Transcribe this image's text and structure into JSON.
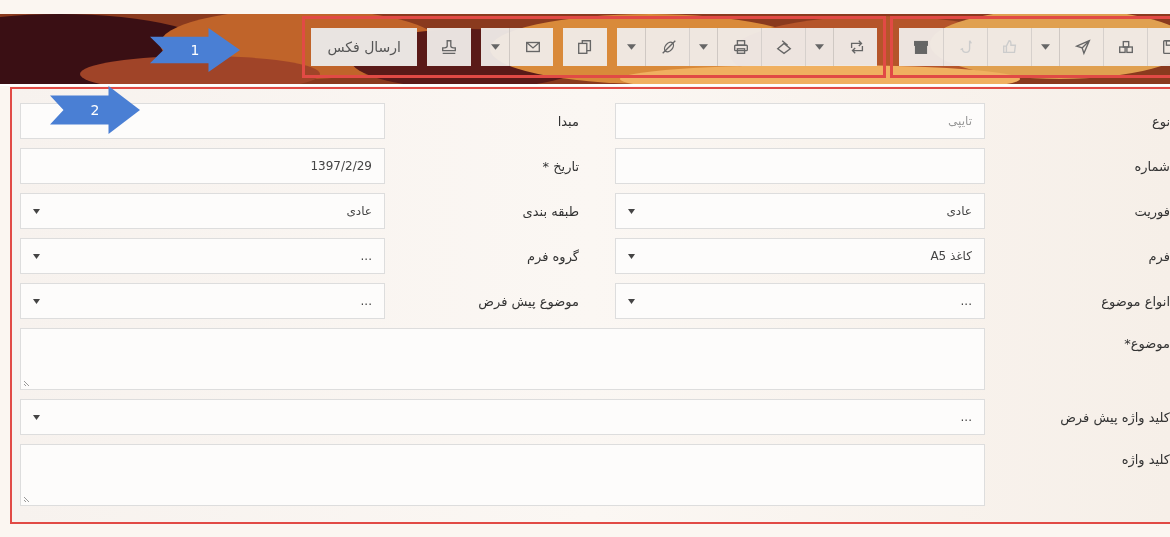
{
  "toolbar": {
    "groups": [
      {
        "segments": [
          [
            {
              "kind": "save",
              "dropdown": false,
              "disabled": false
            },
            {
              "kind": "cubes",
              "dropdown": false,
              "disabled": false
            },
            {
              "kind": "send",
              "dropdown": true,
              "disabled": false
            },
            {
              "kind": "thumb",
              "dropdown": false,
              "disabled": true
            },
            {
              "kind": "hook",
              "dropdown": false,
              "disabled": true
            },
            {
              "kind": "archive",
              "dropdown": false,
              "disabled": false
            }
          ]
        ]
      },
      {
        "segments": [
          [
            {
              "kind": "repeat",
              "dropdown": true,
              "disabled": false
            },
            {
              "kind": "scan",
              "dropdown": false,
              "disabled": false
            },
            {
              "kind": "print",
              "dropdown": true,
              "disabled": false
            },
            {
              "kind": "unlink",
              "dropdown": true,
              "disabled": false
            }
          ],
          [
            {
              "kind": "copy",
              "dropdown": false,
              "disabled": false
            }
          ],
          [
            {
              "kind": "mail",
              "dropdown": true,
              "disabled": false
            }
          ],
          [
            {
              "kind": "stamp",
              "dropdown": false,
              "disabled": false
            }
          ],
          [
            {
              "label": "ارسال فکس",
              "dropdown": false,
              "disabled": false
            }
          ]
        ]
      }
    ]
  },
  "callouts": [
    {
      "number": "1"
    },
    {
      "number": "2"
    }
  ],
  "form": {
    "rows": [
      {
        "fields": [
          {
            "label": "نوع",
            "kind": "text",
            "placeholder": "تایپی"
          },
          {
            "label": "مبدا",
            "kind": "text"
          }
        ]
      },
      {
        "fields": [
          {
            "label": "شماره",
            "kind": "text"
          },
          {
            "label": "تاریخ *",
            "kind": "text",
            "value": "1397/2/29"
          }
        ]
      },
      {
        "fields": [
          {
            "label": "فوریت",
            "kind": "select",
            "value": "عادی"
          },
          {
            "label": "طبقه بندی",
            "kind": "select",
            "value": "عادی"
          }
        ]
      },
      {
        "fields": [
          {
            "label": "فرم",
            "kind": "select",
            "value": "کاغذ A5"
          },
          {
            "label": "گروه فرم",
            "kind": "select",
            "value": "..."
          }
        ]
      },
      {
        "fields": [
          {
            "label": "انواع موضوع",
            "kind": "select",
            "value": "..."
          },
          {
            "label": "موضوع پیش فرض",
            "kind": "select",
            "value": "..."
          }
        ]
      },
      {
        "fields": [
          {
            "label": "موضوع*",
            "kind": "textarea"
          }
        ]
      },
      {
        "fields": [
          {
            "label": "کلید واژه پیش فرض",
            "kind": "select",
            "value": "..."
          }
        ]
      },
      {
        "fields": [
          {
            "label": "کلید واژه",
            "kind": "textarea"
          }
        ]
      }
    ]
  }
}
